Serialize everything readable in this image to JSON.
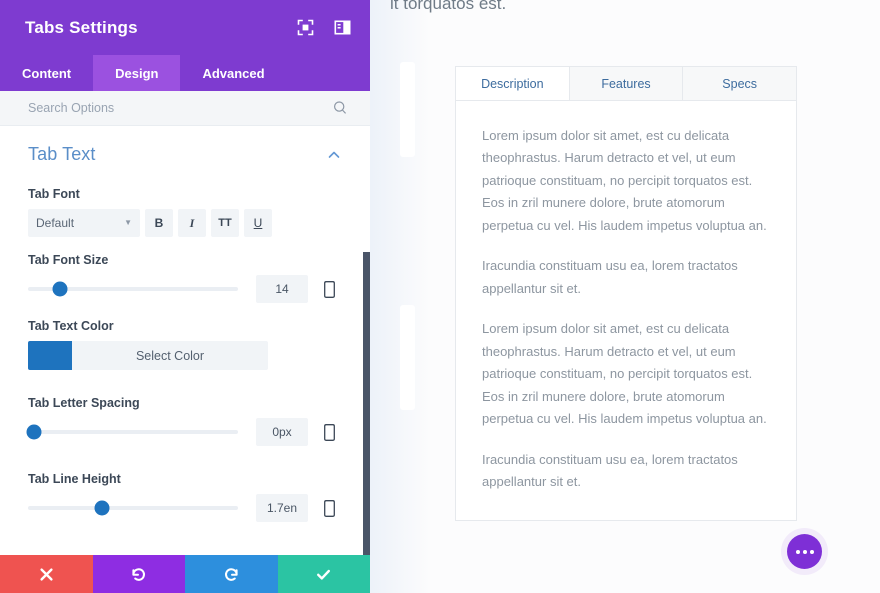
{
  "panel": {
    "title": "Tabs Settings",
    "header_icons": [
      {
        "name": "focus-target-icon"
      },
      {
        "name": "layout-panel-icon"
      }
    ],
    "tabs": [
      {
        "label": "Content",
        "active": false
      },
      {
        "label": "Design",
        "active": true
      },
      {
        "label": "Advanced",
        "active": false
      }
    ],
    "search": {
      "placeholder": "Search Options",
      "value": ""
    },
    "section": {
      "title": "Tab Text",
      "collapsed": false
    },
    "fields": {
      "tab_font": {
        "label": "Tab Font",
        "value": "Default",
        "style_buttons": [
          {
            "name": "bold-button",
            "label": "B"
          },
          {
            "name": "italic-button",
            "label": "I"
          },
          {
            "name": "uppercase-button",
            "label": "TT"
          },
          {
            "name": "underline-button",
            "label": "U"
          }
        ]
      },
      "tab_font_size": {
        "label": "Tab Font Size",
        "value": "14",
        "knob_percent": 15
      },
      "tab_text_color": {
        "label": "Tab Text Color",
        "button_label": "Select Color",
        "swatch_color": "#1E73BE"
      },
      "tab_letter_spacing": {
        "label": "Tab Letter Spacing",
        "value": "0px",
        "knob_percent": 3
      },
      "tab_line_height": {
        "label": "Tab Line Height",
        "value": "1.7en",
        "knob_percent": 35
      }
    },
    "actions": [
      {
        "name": "close-button",
        "icon": "x-icon",
        "color": "#EF5350"
      },
      {
        "name": "undo-button",
        "icon": "undo-icon",
        "color": "#8E2DE2"
      },
      {
        "name": "redo-button",
        "icon": "redo-icon",
        "color": "#2D8FDD"
      },
      {
        "name": "save-button",
        "icon": "check-icon",
        "color": "#2BC4A3"
      }
    ]
  },
  "preview": {
    "cut_off_text": "it torquatos est.",
    "module": {
      "tabs": [
        {
          "label": "Description",
          "active": true
        },
        {
          "label": "Features",
          "active": false
        },
        {
          "label": "Specs",
          "active": false
        }
      ],
      "paragraphs": [
        "Lorem ipsum dolor sit amet, est cu delicata theophrastus. Harum detracto et vel, ut eum patrioque constituam, no percipit torquatos est. Eos in zril munere dolore, brute atomorum perpetua cu vel. His laudem impetus voluptua an.",
        "Iracundia constituam usu ea, lorem tractatos appellantur sit et.",
        "Lorem ipsum dolor sit amet, est cu delicata theophrastus. Harum detracto et vel, ut eum patrioque constituam, no percipit torquatos est. Eos in zril munere dolore, brute atomorum perpetua cu vel. His laudem impetus voluptua an.",
        "Iracundia constituam usu ea, lorem tractatos appellantur sit et."
      ]
    },
    "fab": {
      "name": "more-options-fab"
    }
  }
}
